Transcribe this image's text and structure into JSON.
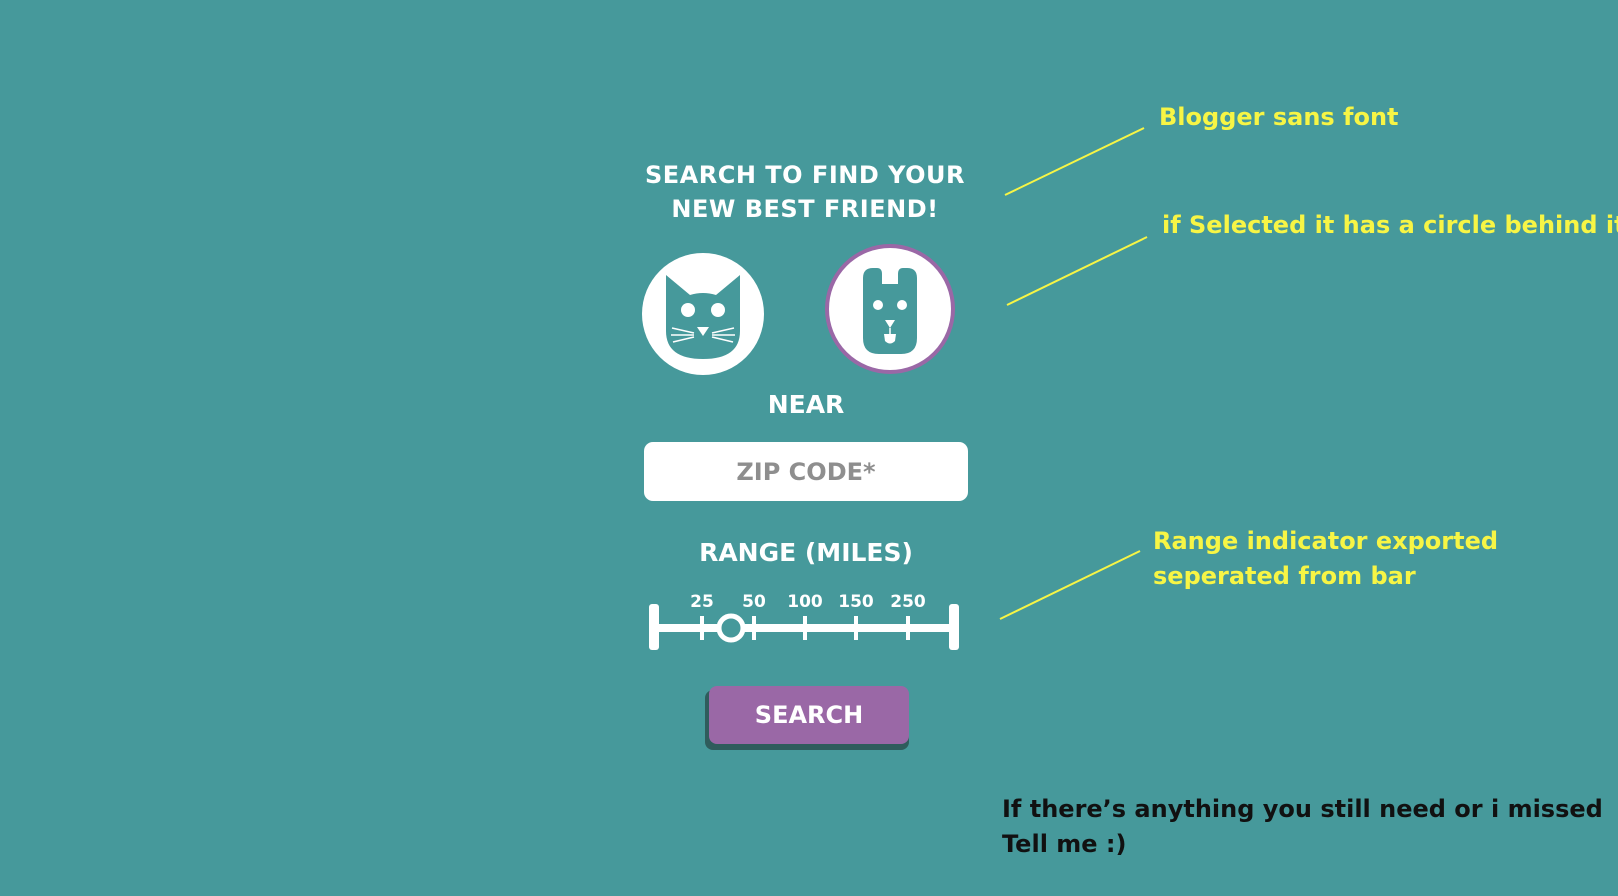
{
  "heading": {
    "line1": "SEARCH TO FIND YOUR",
    "line2": "NEW BEST FRIEND!"
  },
  "pets": [
    {
      "label": "cat",
      "icon": "cat-face-icon",
      "selected": false
    },
    {
      "label": "dog",
      "icon": "dog-face-icon",
      "selected": true
    }
  ],
  "near": {
    "label": "NEAR",
    "zip_placeholder": "ZIP CODE*",
    "zip_value": ""
  },
  "range": {
    "label": "RANGE (MILES)",
    "ticks": [
      "25",
      "50",
      "100",
      "150",
      "250"
    ],
    "value": "between 25 and 50"
  },
  "search_button": "SEARCH",
  "annotations": {
    "font_note": "Blogger sans font",
    "selected_note": "if Selected it has a circle behind it",
    "range_note_line1": "Range indicator exported",
    "range_note_line2": "seperated from bar"
  },
  "footer": {
    "line1": "If there’s anything you still need or i missed",
    "line2": "Tell me :)"
  },
  "colors": {
    "background": "#46999b",
    "accent_purple": "#9a68a6",
    "annotation_yellow": "#f7f545",
    "text_white": "#ffffff"
  }
}
